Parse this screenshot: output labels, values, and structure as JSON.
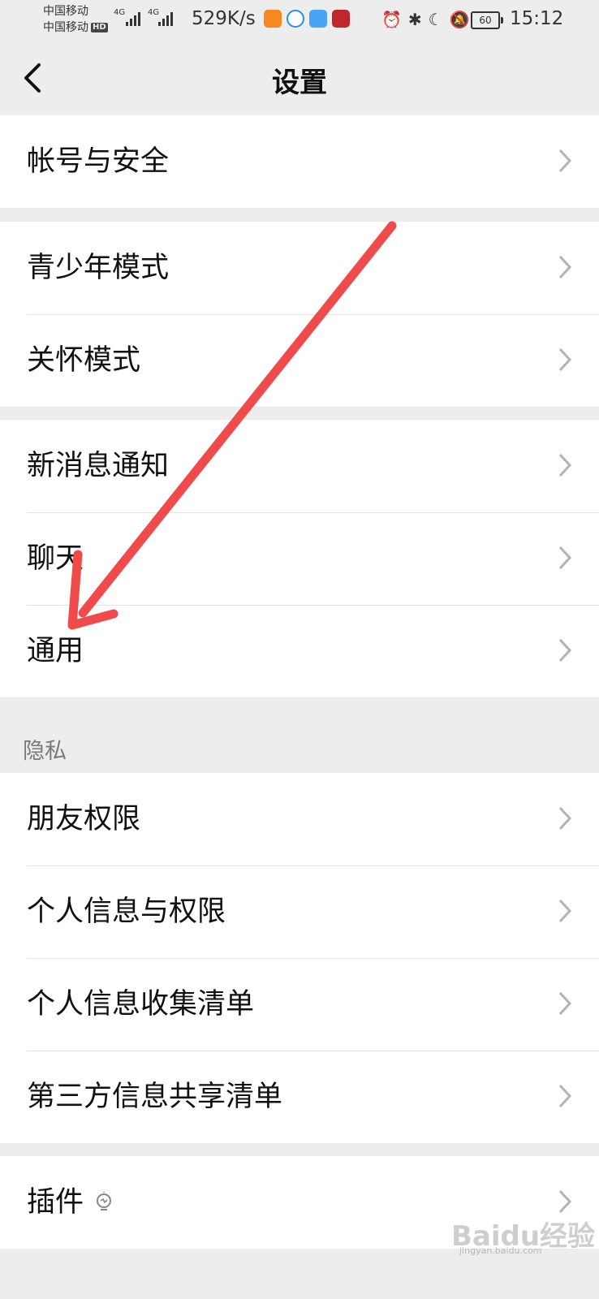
{
  "status_bar": {
    "carrier1": "中国移动",
    "carrier2": "中国移动",
    "hd": "HD",
    "network": "4G",
    "speed": "529K/s",
    "battery": "60",
    "time": "15:12"
  },
  "header": {
    "title": "设置"
  },
  "groups": [
    {
      "items": [
        "帐号与安全"
      ]
    },
    {
      "items": [
        "青少年模式",
        "关怀模式"
      ]
    },
    {
      "items": [
        "新消息通知",
        "聊天",
        "通用"
      ]
    },
    {
      "header": "隐私",
      "items": [
        "朋友权限",
        "个人信息与权限",
        "个人信息收集清单",
        "第三方信息共享清单"
      ]
    },
    {
      "items": [
        "插件"
      ]
    }
  ],
  "watermark": {
    "text": "Baidu经验",
    "url": "jingyan.baidu.com"
  },
  "colors": {
    "background": "#ededed",
    "card": "#ffffff",
    "annotation_arrow": "#f04a4a"
  },
  "icons": [
    "back-arrow-icon",
    "chevron-right-icon",
    "lightbulb-icon"
  ]
}
